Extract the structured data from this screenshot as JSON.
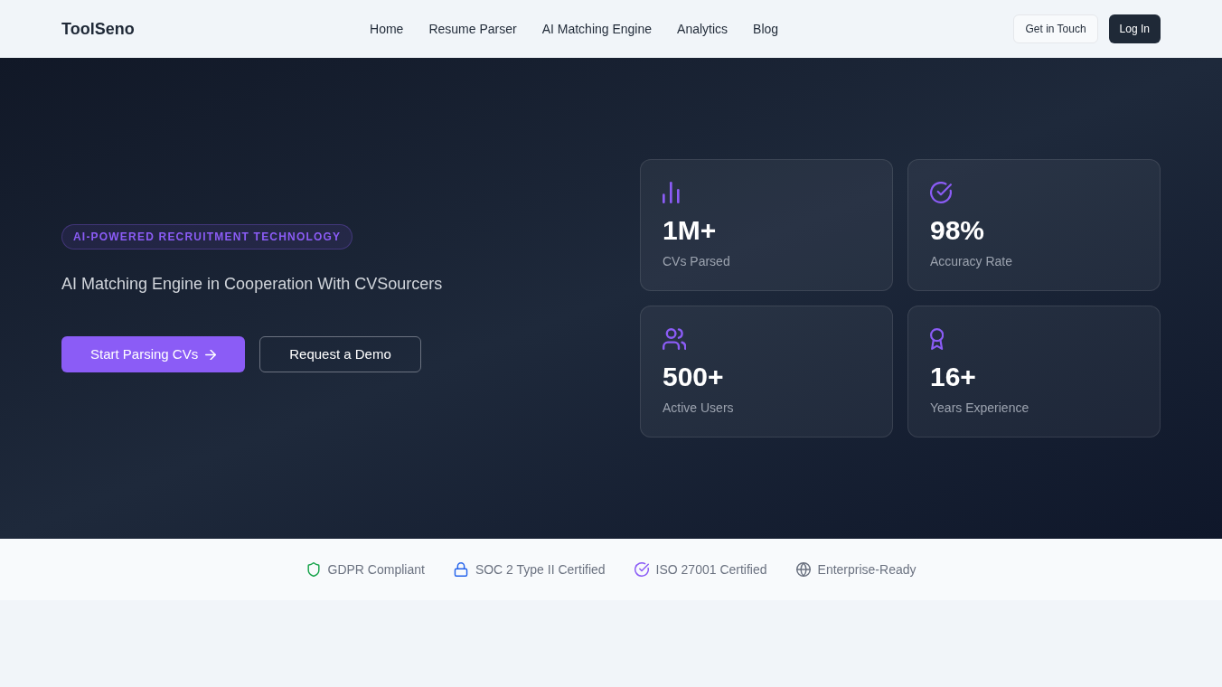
{
  "header": {
    "logo": "ToolSeno",
    "nav": [
      {
        "label": "Home"
      },
      {
        "label": "Resume Parser"
      },
      {
        "label": "AI Matching Engine"
      },
      {
        "label": "Analytics"
      },
      {
        "label": "Blog"
      }
    ],
    "actions": [
      {
        "label": "Get in Touch",
        "kind": "outline"
      },
      {
        "label": "Log In",
        "kind": "solid"
      }
    ]
  },
  "hero": {
    "badge": "AI-POWERED RECRUITMENT TECHNOLOGY",
    "subtitle": "AI Matching Engine in Cooperation With CVSourcers",
    "buttons": [
      {
        "label": "Start Parsing CVs",
        "kind": "primary"
      },
      {
        "label": "Request a Demo",
        "kind": "outline"
      }
    ],
    "stats": [
      {
        "kind": "chart",
        "value": "1M+",
        "label": "CVs Parsed"
      },
      {
        "kind": "check",
        "value": "98%",
        "label": "Accuracy Rate"
      },
      {
        "kind": "users",
        "value": "500+",
        "label": "Active Users"
      },
      {
        "kind": "award",
        "value": "16+",
        "label": "Years Experience"
      }
    ]
  },
  "trust_bar": [
    {
      "kind": "shield",
      "label": "GDPR Compliant",
      "color": "#16a34a"
    },
    {
      "kind": "lock",
      "label": "SOC 2 Type II Certified",
      "color": "#2563eb"
    },
    {
      "kind": "check",
      "label": "ISO 27001 Certified",
      "color": "#8b5cf6"
    },
    {
      "kind": "globe",
      "label": "Enterprise-Ready",
      "color": "#6b7280"
    }
  ]
}
